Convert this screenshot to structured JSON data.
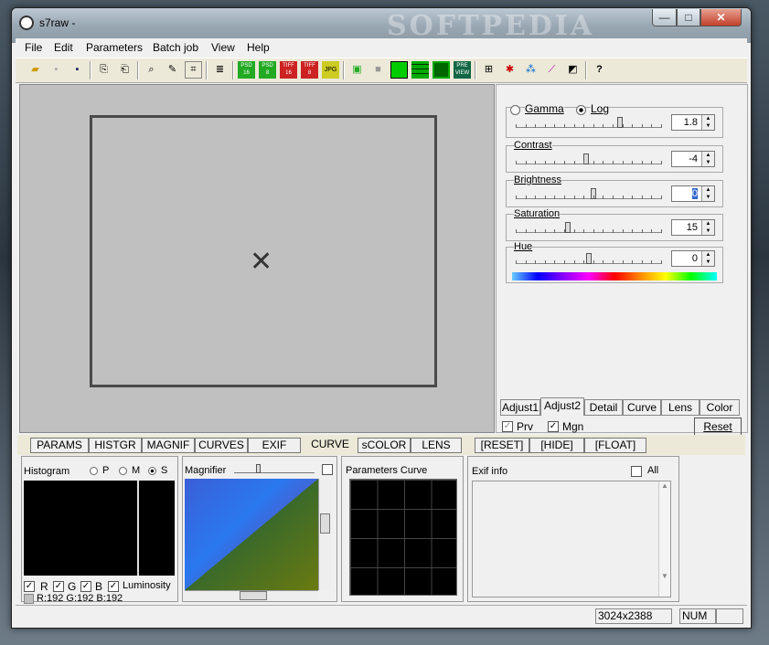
{
  "window": {
    "title": "s7raw -",
    "watermark": "SOFTPEDIA",
    "min": "—",
    "max": "□",
    "close": "✕"
  },
  "menu": [
    "File",
    "Edit",
    "Parameters",
    "Batch job",
    "View",
    "Help"
  ],
  "toolbar": {
    "icons": [
      "open-icon",
      "save-disabled-icon",
      "save-icon",
      "copy-icon",
      "paste-icon",
      "zoom-icon",
      "eyedropper-icon",
      "crop-icon",
      "layers-icon",
      "psd16-icon",
      "psd8-icon",
      "tiff16-icon",
      "tiff8-icon",
      "jpg-icon",
      "batch-icon",
      "gray-icon",
      "green-fill-icon",
      "grid-green-icon",
      "grid-quad-icon",
      "prev-icon",
      "grid-icon",
      "rgb-icon",
      "rgb-circles-icon",
      "wand-icon",
      "compare-icon",
      "help-icon"
    ],
    "labels": {
      "psd16": "PSD 16",
      "psd8": "PSD 8",
      "tiff16": "TIFF 16",
      "tiff8": "TIFF 8",
      "jpg": "JPG",
      "prev": "PRE VIEW",
      "help": "?"
    }
  },
  "adjust": {
    "gamma_label": "Gamma",
    "log_label": "Log",
    "gamma_value": "1.8",
    "contrast_label": "Contrast",
    "contrast_value": "-4",
    "brightness_label": "Brightness",
    "brightness_value": "0",
    "saturation_label": "Saturation",
    "saturation_value": "15",
    "hue_label": "Hue",
    "hue_value": "0",
    "gamma_pos": 0.72,
    "contrast_pos": 0.48,
    "brightness_pos": 0.53,
    "saturation_pos": 0.35,
    "hue_pos": 0.5
  },
  "right_tabs": [
    "Adjust1",
    "Adjust2",
    "Detail",
    "Curve",
    "Lens",
    "Color"
  ],
  "right_bottom": {
    "prv": "Prv",
    "mgn": "Mgn",
    "reset": "Reset"
  },
  "bottom_tabs": [
    "PARAMS",
    "HISTGR",
    "MAGNIF",
    "CURVES",
    "EXIF",
    "CURVE",
    "sCOLOR",
    "LENS",
    "[RESET]",
    "[HIDE]",
    "[FLOAT]"
  ],
  "histogram": {
    "title": "Histogram",
    "p": "P",
    "m": "M",
    "s": "S",
    "r": "R",
    "g": "G",
    "b": "B",
    "lum": "Luminosity",
    "readout": "R:192 G:192 B:192"
  },
  "magnifier": {
    "title": "Magnifier"
  },
  "params_curve": {
    "title": "Parameters Curve"
  },
  "exif": {
    "title": "Exif info",
    "all": "All"
  },
  "status": {
    "dims": "3024x2388",
    "num": "NUM"
  }
}
